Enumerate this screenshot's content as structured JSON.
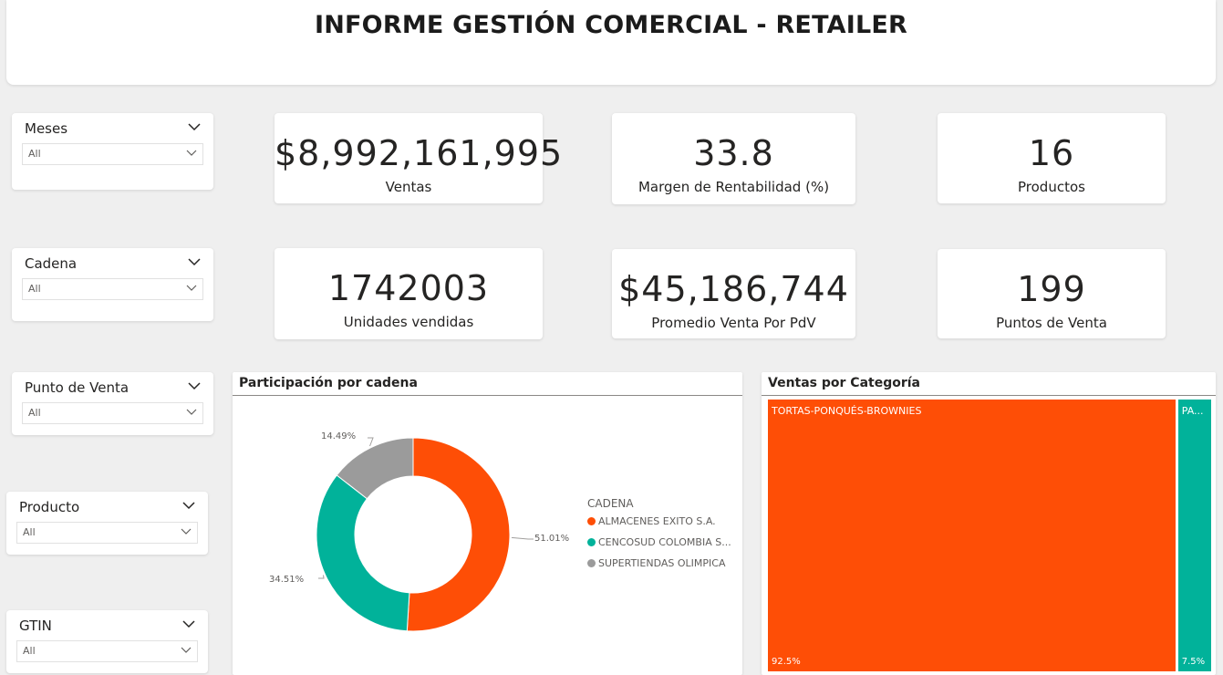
{
  "header": {
    "title": "INFORME GESTIÓN COMERCIAL - RETAILER"
  },
  "slicers": [
    {
      "title": "Meses",
      "value": "All"
    },
    {
      "title": "Cadena",
      "value": "All"
    },
    {
      "title": "Punto de Venta",
      "value": "All"
    },
    {
      "title": "Producto",
      "value": "All"
    },
    {
      "title": "GTIN",
      "value": "All"
    }
  ],
  "kpis": [
    {
      "value": "$8,992,161,995",
      "label": "Ventas"
    },
    {
      "value": "33.8",
      "label": "Margen de Rentabilidad (%)"
    },
    {
      "value": "16",
      "label": "Productos"
    },
    {
      "value": "1742003",
      "label": "Unidades vendidas"
    },
    {
      "value": "$45,186,744",
      "label": "Promedio Venta Por PdV"
    },
    {
      "value": "199",
      "label": "Puntos de Venta"
    }
  ],
  "donut": {
    "title": "Participación por cadena",
    "legend_title": "CADENA",
    "legend": [
      {
        "label": "ALMACENES EXITO S.A.",
        "color": "#fe4e06"
      },
      {
        "label": "CENCOSUD COLOMBIA S...",
        "color": "#01b29a"
      },
      {
        "label": "SUPERTIENDAS OLIMPICA",
        "color": "#9b9b9b"
      }
    ],
    "labels": [
      "51.01%",
      "34.51%",
      "14.49%"
    ]
  },
  "treemap": {
    "title": "Ventas por Categoría",
    "cells": [
      {
        "name": "TORTAS-PONQUÉS-BROWNIES",
        "pct": "92.5%",
        "color": "#fe4e06"
      },
      {
        "name": "PA...",
        "pct": "7.5%",
        "color": "#01b29a"
      }
    ]
  },
  "chart_data": [
    {
      "type": "pie",
      "title": "Participación por cadena",
      "legend_title": "CADENA",
      "categories": [
        "ALMACENES EXITO S.A.",
        "CENCOSUD COLOMBIA S...",
        "SUPERTIENDAS OLIMPICA"
      ],
      "values": [
        51.01,
        34.51,
        14.49
      ],
      "colors": [
        "#fe4e06",
        "#01b29a",
        "#9b9b9b"
      ],
      "legend_placement": "right"
    },
    {
      "type": "treemap",
      "title": "Ventas por Categoría",
      "categories": [
        "TORTAS-PONQUÉS-BROWNIES",
        "PA..."
      ],
      "values": [
        92.5,
        7.5
      ],
      "colors": [
        "#fe4e06",
        "#01b29a"
      ]
    }
  ]
}
